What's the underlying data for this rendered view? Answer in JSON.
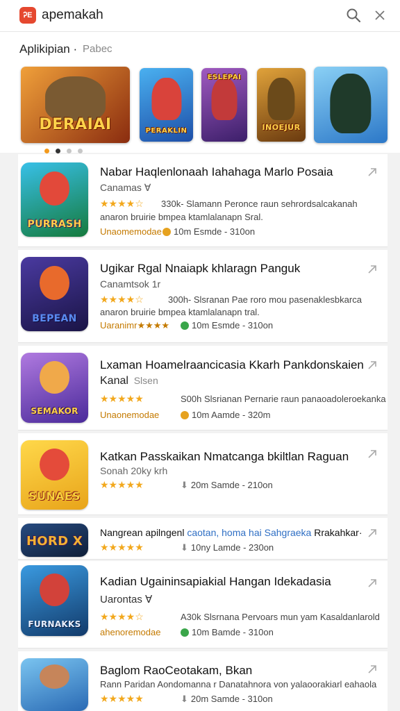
{
  "header": {
    "logo": "ᎮE",
    "app_name": "apemakah",
    "search_icon": "search-icon",
    "close_icon": "close-icon"
  },
  "section": {
    "title": "Aplikipian ·",
    "subtitle": "Pabec"
  },
  "carousel": {
    "banners": [
      {
        "text": "DERAIAI",
        "bg": "#c8561d",
        "figure": "#8a6a3a"
      },
      {
        "text": "PERAKLIN",
        "bg": "#2c6fd6",
        "figure": "#d9433b"
      },
      {
        "text": "ESLEPAI",
        "bg": "#7a3d9a",
        "figure": "#c23a3a"
      },
      {
        "text": "INOEJUR",
        "bg": "#b3741b",
        "figure": "#6b4a1a"
      },
      {
        "text": "",
        "bg": "#3a8bd8",
        "figure": "#1f3a2a"
      }
    ],
    "active_index": 1
  },
  "apps": [
    {
      "title": "Nabar Haqlenlonaah Iahahaga Marlo Posaia",
      "subtitle": "Canamas ∀",
      "stars": "★★★★☆",
      "rating_text": "330k- Slamann Peronce raun sehrordsalcakanah",
      "desc": "anaron bruirie bmpea ktamlalanapn Sral.",
      "badge": "Unaomemodae",
      "badge_dot_color": "#e6a21f",
      "meta": "10m  Esmde - 310on",
      "icon_text": "PURRASH",
      "icon_bg": "#2aa0d8",
      "icon_face": "#e2493a"
    },
    {
      "title": "Ugikar Rgal Nnaiapk khlaragn Panguk",
      "subtitle": "Canamtsok 1r",
      "stars": "★★★★☆",
      "rating_text": "300h- Slsranan Pae roro mou pasenaklesbkarca",
      "desc": "anaron bruirie bmpea ktamlalanapn tral.",
      "badge": "Uaranimr★★★★",
      "badge_dot_color": "#3aa64a",
      "meta": "10m  Esmde - 310on",
      "icon_text": "BEPEAN",
      "icon_bg": "#3b2f7e",
      "icon_face": "#e86a2c"
    },
    {
      "title": "Lxaman Hoamelraancicasia Kkarh Pankdonskaien",
      "subtitle": "Kanal",
      "subtitle2": "Slsen",
      "stars": "★★★★★",
      "rating_text": "S00h  Slsrianan Pernarie raun panaoadoleroekanka",
      "badge": "Unaonemodae",
      "badge_dot_color": "#e6a21f",
      "meta": "10m  Aamde - 320m",
      "icon_text": "SEMAKOR",
      "icon_bg": "#8a54c7",
      "icon_face": "#f0a94a"
    },
    {
      "title": "Katkan Passkaikan Nmatcanga bkiltlan Raguan",
      "subtitle": "Sonah 20ky krh",
      "stars": "★★★★★",
      "meta": "20m  Samde - 210on",
      "icon_text": "SUNAES",
      "icon_bg": "#f2c12a",
      "icon_face": "#e44b3a"
    },
    {
      "title_a": "Nangrean apilngenl",
      "title_b": "caotan, homa hai Sahgraeka",
      "title_c": "Rrakahkar·",
      "stars": "★★★★★",
      "meta": "10ny  Lamde - 230on",
      "icon_text": "HORD X",
      "icon_bg": "#1e3a63",
      "icon_face": "#f2b233"
    },
    {
      "title": "Kadian Ugaininsapiakial Hangan Idekadasia",
      "subtitle": "Uarontas ∀",
      "stars": "★★★★☆",
      "rating_text": "A30k  Slsrnana Pervoars mun yam Kasaldanlarold",
      "badge": "ahenoremodae",
      "badge_dot_color": "#3aa64a",
      "meta": "10m  Bamde - 310on",
      "icon_text": "FURNAKKS",
      "icon_bg": "#2a7ac4",
      "icon_face": "#d2423a"
    },
    {
      "title": "Baglom RaoCeotakam, Bkan",
      "subtitle": "Rann Paridan Aondomanna r Danatahnora von yalaoorakiarl eahaola",
      "stars": "★★★★★",
      "meta": "20m  Samde - 310on",
      "icon_text": "",
      "icon_bg": "#4aa0e0",
      "icon_face": "#c6855a"
    }
  ]
}
